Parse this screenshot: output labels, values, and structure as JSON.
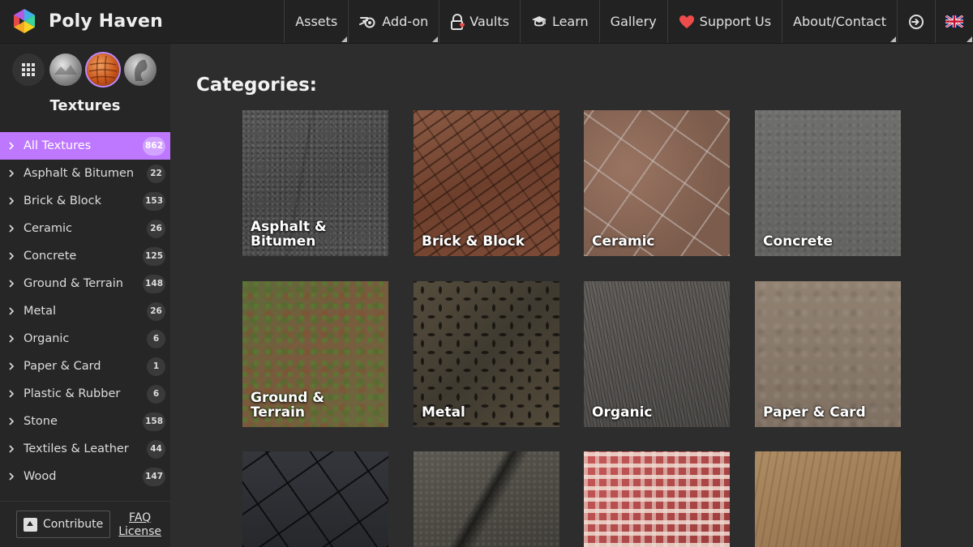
{
  "header": {
    "brand": "Poly Haven",
    "nav": [
      {
        "label": "Assets",
        "icon": "",
        "has_menu": true
      },
      {
        "label": "Add-on",
        "icon": "blender-icon",
        "has_menu": true
      },
      {
        "label": "Vaults",
        "icon": "lock-heart-icon",
        "has_menu": false
      },
      {
        "label": "Learn",
        "icon": "graduation-cap-icon",
        "has_menu": false
      },
      {
        "label": "Gallery",
        "icon": "",
        "has_menu": false
      },
      {
        "label": "Support Us",
        "icon": "heart-icon",
        "has_menu": false
      },
      {
        "label": "About/Contact",
        "icon": "",
        "has_menu": true
      }
    ],
    "login_icon": "login-icon",
    "language_flag": "uk-flag-icon"
  },
  "sidebar": {
    "asset_types": [
      "all-assets",
      "hdris",
      "textures",
      "models"
    ],
    "title": "Textures",
    "categories": [
      {
        "label": "All Textures",
        "count": "862",
        "active": true
      },
      {
        "label": "Asphalt & Bitumen",
        "count": "22"
      },
      {
        "label": "Brick & Block",
        "count": "153"
      },
      {
        "label": "Ceramic",
        "count": "26"
      },
      {
        "label": "Concrete",
        "count": "125"
      },
      {
        "label": "Ground & Terrain",
        "count": "148"
      },
      {
        "label": "Metal",
        "count": "26"
      },
      {
        "label": "Organic",
        "count": "6"
      },
      {
        "label": "Paper & Card",
        "count": "1"
      },
      {
        "label": "Plastic & Rubber",
        "count": "6"
      },
      {
        "label": "Stone",
        "count": "158"
      },
      {
        "label": "Textiles & Leather",
        "count": "44"
      },
      {
        "label": "Wood",
        "count": "147"
      }
    ],
    "footer": {
      "contribute": "Contribute",
      "faq": "FAQ",
      "license": "License"
    }
  },
  "main": {
    "heading": "Categories:",
    "tiles": [
      {
        "label": "Asphalt & Bitumen",
        "texture": "asphalt"
      },
      {
        "label": "Brick & Block",
        "texture": "brick"
      },
      {
        "label": "Ceramic",
        "texture": "ceramic"
      },
      {
        "label": "Concrete",
        "texture": "concrete"
      },
      {
        "label": "Ground & Terrain",
        "texture": "ground"
      },
      {
        "label": "Metal",
        "texture": "metal"
      },
      {
        "label": "Organic",
        "texture": "organic"
      },
      {
        "label": "Paper & Card",
        "texture": "paper"
      },
      {
        "label": "",
        "texture": "plastic"
      },
      {
        "label": "",
        "texture": "stone"
      },
      {
        "label": "",
        "texture": "textile"
      },
      {
        "label": "",
        "texture": "wood"
      }
    ]
  },
  "colors": {
    "accent": "#be78ff",
    "header_bg": "#222222",
    "sidebar_bg": "#262626",
    "main_bg": "#2d2d2d"
  }
}
